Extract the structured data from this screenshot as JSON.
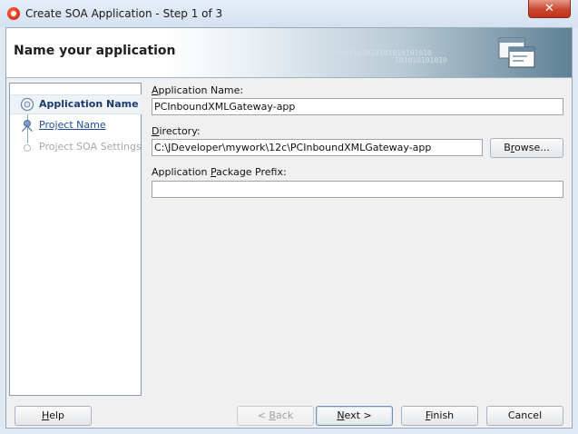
{
  "window": {
    "title": "Create SOA Application - Step 1 of 3",
    "close_label": "✕"
  },
  "header": {
    "title": "Name your application",
    "binary_line1": "01010101010101010101010",
    "binary_line2": "101010101010"
  },
  "steps": [
    {
      "label": "Application Name",
      "state": "current"
    },
    {
      "label": "Project Name",
      "state": "link"
    },
    {
      "label": "Project SOA Settings",
      "state": "disabled"
    }
  ],
  "form": {
    "app_name_label": "Application Name:",
    "app_name_value": "PCInboundXMLGateway-app",
    "directory_label": "Directory:",
    "directory_value": "C:\\JDeveloper\\mywork\\12c\\PCInboundXMLGateway-app",
    "browse_label": "Browse...",
    "prefix_label": "Application Package Prefix:",
    "prefix_value": ""
  },
  "buttons": {
    "help": "Help",
    "back": "< Back",
    "next": "Next >",
    "finish": "Finish",
    "cancel": "Cancel"
  }
}
